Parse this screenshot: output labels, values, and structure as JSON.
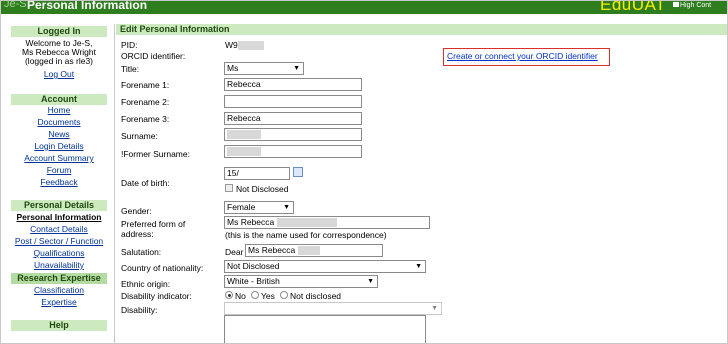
{
  "topbar": {
    "brand": "Je-S",
    "title": "Personal Information",
    "logo": "EduUAT",
    "high_contrast": "High Cont"
  },
  "sidebar": {
    "logged_in": {
      "heading": "Logged In",
      "line1": "Welcome to Je-S,",
      "line2": "Ms Rebecca Wright",
      "line3": "(logged in as rle3)",
      "logout": "Log Out"
    },
    "account": {
      "heading": "Account",
      "items": [
        "Home",
        "Documents",
        "News",
        "Login Details",
        "Account Summary",
        "Forum",
        "Feedback"
      ]
    },
    "personal_details": {
      "heading": "Personal Details",
      "items": [
        "Personal Information",
        "Contact Details",
        "Post / Sector / Function",
        "Qualifications",
        "Unavailability"
      ]
    },
    "research_expertise": {
      "heading": "Research Expertise",
      "items": [
        "Classification",
        "Expertise"
      ]
    },
    "help": {
      "heading": "Help"
    }
  },
  "form": {
    "heading": "Edit Personal Information",
    "pid_label": "PID:",
    "pid_value": "W9",
    "orcid_label": "ORCID identifier:",
    "orcid_link": "Create or connect your ORCID identifier",
    "title_label": "Title:",
    "title_value": "Ms",
    "forename1_label": "Forename 1:",
    "forename1_value": "Rebecca",
    "forename2_label": "Forename 2:",
    "forename2_value": "",
    "forename3_label": "Forename 3:",
    "forename3_value": "Rebecca",
    "surname_label": "Surname:",
    "former_surname_label": "!Former Surname:",
    "dob_label": "Date of birth:",
    "dob_value": "15/",
    "not_disclosed": "Not Disclosed",
    "gender_label": "Gender:",
    "gender_value": "Female",
    "preferred_label_1": "Preferred form of",
    "preferred_label_2": "address:",
    "preferred_value": "Ms Rebecca",
    "preferred_note": "(this is the name used for correspondence)",
    "salutation_label": "Salutation:",
    "salutation_prefix": "Dear",
    "salutation_value": "Ms Rebecca",
    "nationality_label": "Country of nationality:",
    "nationality_value": "Not Disclosed",
    "ethnic_label": "Ethnic origin:",
    "ethnic_value": "White - British",
    "disability_indicator_label": "Disability indicator:",
    "disability_options": [
      "No",
      "Yes",
      "Not disclosed"
    ],
    "disability_selected": "No",
    "disability_label": "Disability:"
  }
}
